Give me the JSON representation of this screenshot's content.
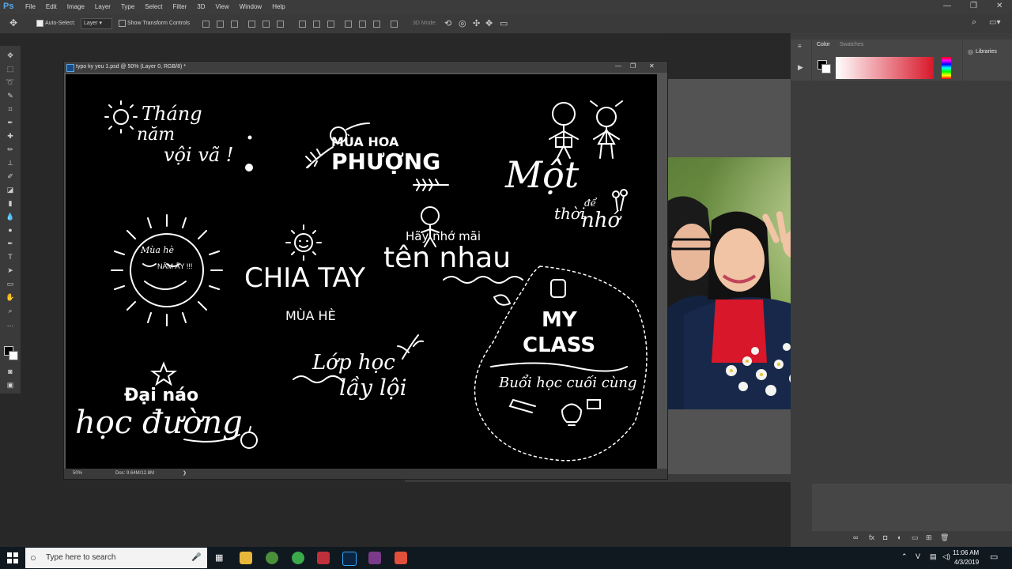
{
  "app": {
    "logo": "Ps"
  },
  "menu": {
    "items": [
      "File",
      "Edit",
      "Image",
      "Layer",
      "Type",
      "Select",
      "Filter",
      "3D",
      "View",
      "Window",
      "Help"
    ]
  },
  "window_controls": {
    "minimize": "—",
    "maximize": "❐",
    "close": "✕"
  },
  "options_bar": {
    "auto_select_label": "Auto-Select:",
    "auto_select_value": "Layer",
    "show_transform_label": "Show Transform Controls",
    "mode_3d_label": "3D Mode:"
  },
  "document": {
    "title": "typo ky yeu 1.psd @ 50% (Layer 0, RGB/8) *",
    "zoom": "50%",
    "doc_info": "Doc: 9.64M/12.8M",
    "artwork": {
      "thang_line1": "Tháng",
      "thang_line2": "năm",
      "thang_line3": "vội vã !",
      "mua_hoa": "MÙA HOA",
      "phuong": "PHƯỢNG",
      "mot": "Một",
      "de": "để",
      "thoi": "thời",
      "nho": "nhớ",
      "mua_he_small": "Mùa hè",
      "nam_ay": "NĂM ẤY !!!",
      "chia_tay": "CHIA TAY",
      "mua_he_caps": "MÙA HÈ",
      "hay_nho_mai": "Hãy nhớ mãi",
      "ten_nhau": "tên nhau",
      "my": "MY",
      "class": "CLASS",
      "buoi_hoc": "Buổi học cuối cùng",
      "lop_hoc": "Lớp học",
      "lay_loi": "lầy lội",
      "dai_nao": "Đại náo",
      "hoc_duong": "học đường"
    }
  },
  "panels": {
    "tabs": [
      "Color",
      "Swatches"
    ],
    "libraries": "Libraries"
  },
  "taskbar": {
    "search_placeholder": "Type here to search",
    "time": "11:06 AM",
    "date": "4/3/2019"
  },
  "colors": {
    "ui_dark": "#282828",
    "canvas_bg": "#000000",
    "accent_red": "#d8172a"
  }
}
